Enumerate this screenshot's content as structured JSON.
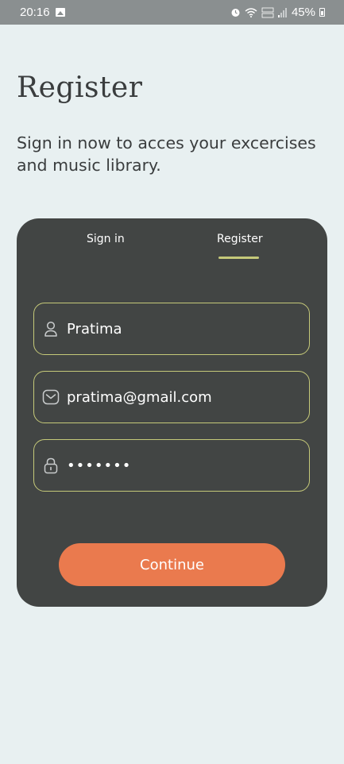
{
  "status_bar": {
    "time": "20:16",
    "battery": "45%",
    "icons": [
      "gallery-icon",
      "alarm-icon",
      "wifi-icon",
      "volte-lte-icon",
      "signal-icon",
      "battery-icon"
    ]
  },
  "page": {
    "title": "Register",
    "subtitle": "Sign in now to acces your excercises and music library."
  },
  "tabs": [
    {
      "label": "Sign in",
      "active": false
    },
    {
      "label": "Register",
      "active": true
    }
  ],
  "form": {
    "name": {
      "value": "Pratima",
      "icon": "user-icon"
    },
    "email": {
      "value": "pratima@gmail.com",
      "icon": "mail-icon"
    },
    "password": {
      "value": "•••••••",
      "icon": "lock-icon"
    },
    "submit_label": "Continue"
  },
  "colors": {
    "background": "#e8f0f1",
    "card": "#424544",
    "accent": "#c5c979",
    "button": "#ea7a4e",
    "text_dark": "#3a3d3e"
  }
}
